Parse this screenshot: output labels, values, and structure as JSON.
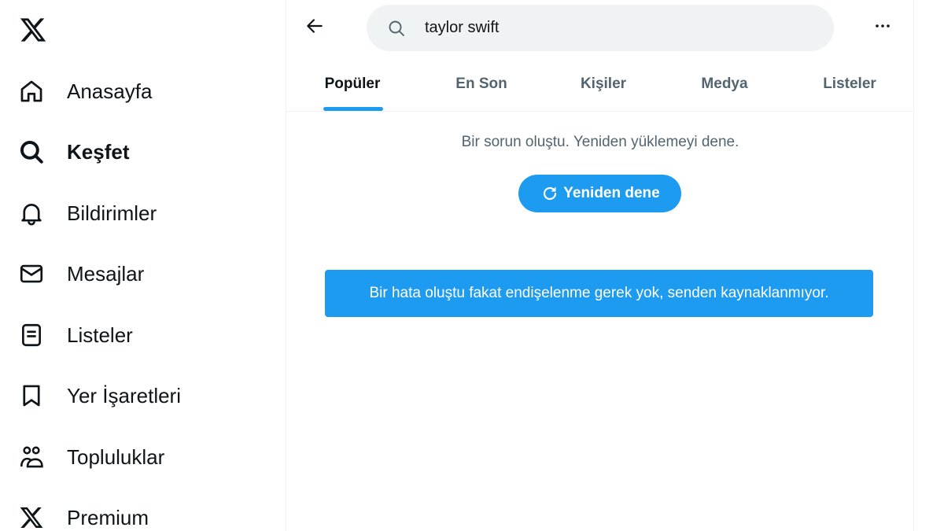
{
  "sidebar": {
    "logo_icon": "x-logo-icon",
    "items": [
      {
        "label": "Anasayfa",
        "icon": "home-icon"
      },
      {
        "label": "Keşfet",
        "icon": "search-icon",
        "active": true
      },
      {
        "label": "Bildirimler",
        "icon": "bell-icon"
      },
      {
        "label": "Mesajlar",
        "icon": "envelope-icon"
      },
      {
        "label": "Listeler",
        "icon": "list-icon"
      },
      {
        "label": "Yer İşaretleri",
        "icon": "bookmark-icon"
      },
      {
        "label": "Topluluklar",
        "icon": "communities-icon"
      },
      {
        "label": "Premium",
        "icon": "x-logo-icon"
      }
    ]
  },
  "header": {
    "search_value": "taylor swift",
    "back_icon": "arrow-left-icon",
    "more_icon": "more-horizontal-icon"
  },
  "tabs": [
    {
      "label": "Popüler",
      "active": true
    },
    {
      "label": "En Son"
    },
    {
      "label": "Kişiler"
    },
    {
      "label": "Medya"
    },
    {
      "label": "Listeler"
    }
  ],
  "content": {
    "error_message": "Bir sorun oluştu. Yeniden yüklemeyi dene.",
    "retry_label": "Yeniden dene",
    "retry_icon": "refresh-icon",
    "toast_message": "Bir hata oluştu fakat endişelenme gerek yok, senden kaynaklanmıyor."
  },
  "colors": {
    "accent": "#1d9bf0",
    "text_primary": "#0f1419",
    "text_secondary": "#536471",
    "search_bg": "#eff3f4"
  }
}
